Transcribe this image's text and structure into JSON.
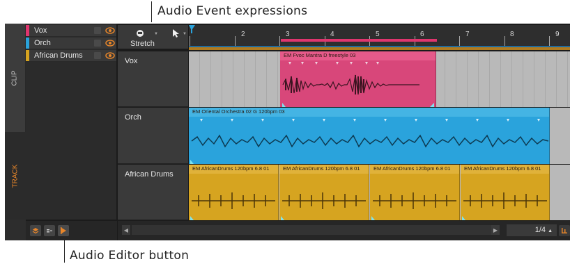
{
  "callouts": {
    "top": "Audio Event expressions",
    "bottom": "Audio Editor button"
  },
  "sidebar": {
    "tabs": [
      {
        "label": "CLIP",
        "active": true
      },
      {
        "label": "TRACK",
        "active": false
      }
    ]
  },
  "tracks": [
    {
      "name": "Vox",
      "color": "#e0356e"
    },
    {
      "name": "Orch",
      "color": "#2aa3dc"
    },
    {
      "name": "African Drums",
      "color": "#d6a420"
    }
  ],
  "toolbar": {
    "stretch_label": "Stretch"
  },
  "ruler": {
    "bars": [
      "2",
      "3",
      "4",
      "5",
      "6",
      "7",
      "8",
      "9"
    ]
  },
  "clips": {
    "vox": [
      {
        "title": "EM Fvoc Mantra D freestyle 03"
      }
    ],
    "orch": [
      {
        "title": "EM Oriental Orchestra 02 G 120bpm 03"
      }
    ],
    "drums": [
      {
        "title": "EM AfricanDrums 120bpm 6.8 01"
      },
      {
        "title": "EM AfricanDrums 120bpm 6.8 01"
      },
      {
        "title": "EM AfricanDrums 120bpm 6.8 01"
      },
      {
        "title": "EM AfricanDrums 120bpm 6.8 01"
      }
    ]
  },
  "footer": {
    "quantize": "1/4"
  },
  "colors": {
    "vox": "#e0356e",
    "orch": "#2aa3dc",
    "drums": "#d6a420",
    "accent": "#e8862a"
  }
}
